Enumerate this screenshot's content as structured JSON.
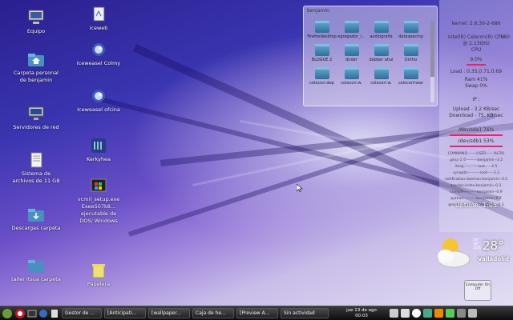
{
  "desktop": {
    "col1": [
      {
        "label": "Equipo",
        "icon": "computer-icon"
      },
      {
        "label": "Carpeta personal de benjamin",
        "icon": "home-folder-icon"
      },
      {
        "label": "Servidores de red",
        "icon": "network-servers-icon"
      },
      {
        "label": "Sistema de archivos de 11 GB",
        "icon": "filesystem-icon"
      },
      {
        "label": "Descargas carpeta",
        "icon": "downloads-folder-icon"
      },
      {
        "label": "taller itsua carpeta",
        "icon": "folder-icon"
      }
    ],
    "col2": [
      {
        "label": "iceweb",
        "icon": "document-icon"
      },
      {
        "label": "Iceweasel Colmy",
        "icon": "iceweasel-icon"
      },
      {
        "label": "Iceweasel ofcina",
        "icon": "iceweasel-icon"
      },
      {
        "label": "Kerkyhea",
        "icon": "app-icon"
      },
      {
        "label": "vcmil_setup.exe Exee507k8... ejecutable de DOS/ Windows",
        "icon": "exe-icon"
      },
      {
        "label": "Papelera",
        "icon": "trash-icon"
      }
    ]
  },
  "folder_window": {
    "title": "benjamin",
    "items": [
      "Firefoxdesktop",
      "egregador_i...",
      "audiografia",
      "dataspacing",
      "BLOGUE 2",
      "dirder",
      "dabber ahul",
      "Dirtho",
      "colocorr.dep",
      "colocorr.w.",
      "colocorr.w.",
      "colocorrnear"
    ]
  },
  "conky": {
    "kernel": "kernel: 2.6.30-2-686",
    "cpu_model": "Intel(R) Celeron(R) CPU",
    "cpu_model2": "@ 2.13GHz",
    "cpu_mhz": "560",
    "cpu_label": "CPU",
    "cpu_value": "9.0%",
    "load": "Load : 0.35,0.71,0.69",
    "ram": "Ram 41%",
    "swap": "Swap 0%",
    "ip": "IP :",
    "upload": "Upload - 3.2 KB/sec",
    "download": "Download - 75. KB/sec",
    "disk1": "/dev/sda1 76%",
    "disk2": "/dev/sdb1 53%",
    "proc_header": "COMMAND-------USER------%CPU",
    "procs": [
      "gimp-2.6---------benjamin--3.2",
      "Xorg-----------root-----4.5",
      "synaptic---------root-----3.3",
      "notification-daemon-benjamin--0.5",
      "tracker-index-benjamin--0.3",
      "conkyd-----------benjamin--0.9",
      "python----------benjamin--0.3",
      "gnome-panel-----benjamin--0.3"
    ],
    "uptime": "Uptime: 1:05"
  },
  "weather": {
    "temp": "28°",
    "city": "Valladolid",
    "small": [
      "29°",
      "18°",
      "20%"
    ]
  },
  "widget_label": "Computer On Off",
  "taskbar": {
    "tasks": [
      "Gestor de ...",
      "[Anticipati...",
      "[wallpaper...",
      "Caja de he...",
      "[Preview A...",
      "Sin actividad"
    ],
    "clock_date": "jue 13 de ago",
    "clock_time": "00:03"
  },
  "colors": {
    "accent": "#e22266",
    "taskbar": "#1a1a1a"
  }
}
